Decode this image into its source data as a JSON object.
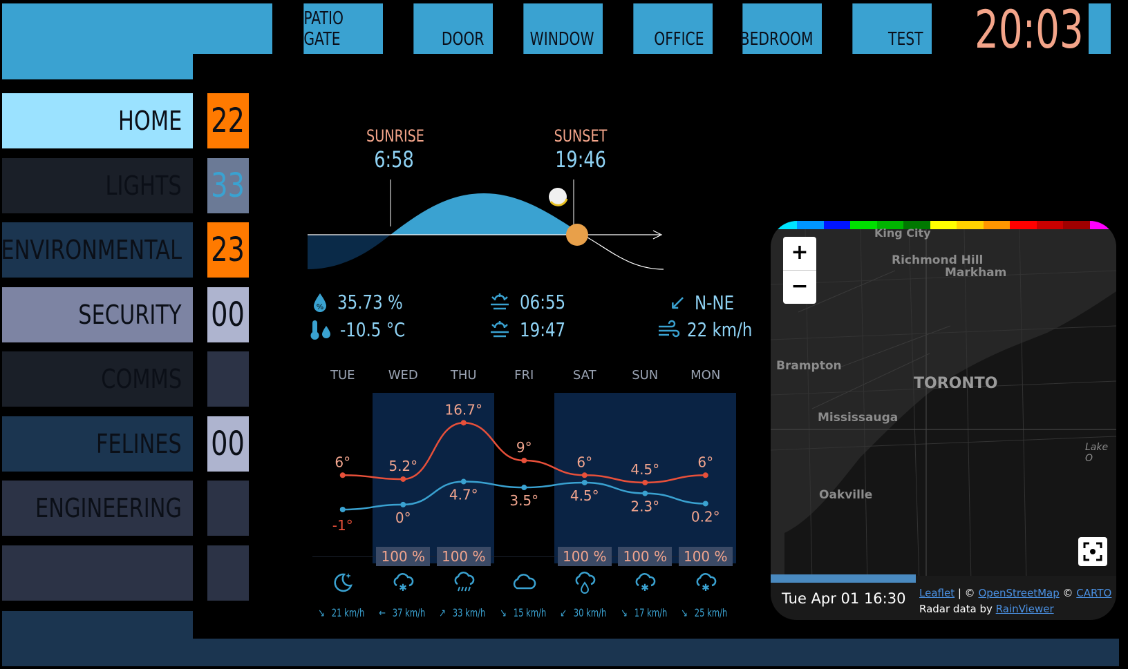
{
  "clock": "20:03",
  "doors": [
    "PATIO GATE",
    "DOOR",
    "WINDOW",
    "OFFICE",
    "BEDROOM",
    "TEST"
  ],
  "sidebar": {
    "items": [
      {
        "label": "HOME",
        "count": "22",
        "bg": "#9be2ff",
        "count_bg": "#ff7a00",
        "count_color": "#0b0f17"
      },
      {
        "label": "LIGHTS",
        "count": "33",
        "bg": "#1a1f28",
        "count_bg": "#6b7a96",
        "count_color": "#3aa2d1"
      },
      {
        "label": "ENVIRONMENTAL",
        "count": "23",
        "bg": "#1b3550",
        "count_bg": "#ff7a00",
        "count_color": "#0b0f17"
      },
      {
        "label": "SECURITY",
        "count": "00",
        "bg": "#7d84a3",
        "count_bg": "#aeb4cf",
        "count_color": "#0b0f17"
      },
      {
        "label": "COMMS",
        "count": "",
        "bg": "#1a1f28",
        "count_bg": "#2c3346",
        "count_color": "#0b0f17"
      },
      {
        "label": "FELINES",
        "count": "00",
        "bg": "#1b3550",
        "count_bg": "#aeb4cf",
        "count_color": "#0b0f17"
      },
      {
        "label": "ENGINEERING",
        "count": "",
        "bg": "#2c3346",
        "count_bg": "#2c3346",
        "count_color": "#0b0f17"
      },
      {
        "label": "",
        "count": "",
        "bg": "#2c3346",
        "count_bg": "#2c3346",
        "count_color": "#0b0f17"
      }
    ]
  },
  "sun": {
    "sunrise_label": "SUNRISE",
    "sunrise_time": "6:58",
    "sunset_label": "SUNSET",
    "sunset_time": "19:46"
  },
  "stats": {
    "humidity": "35.73 %",
    "temperature": "-10.5 °C",
    "sunrise_next": "06:55",
    "sunset_next": "19:47",
    "wind_dir": "N-NE",
    "wind_speed": "22 km/h"
  },
  "forecast": {
    "days": [
      "TUE",
      "WED",
      "THU",
      "FRI",
      "SAT",
      "SUN",
      "MON"
    ],
    "high_labels": [
      "6°",
      "5.2°",
      "16.7°",
      "9°",
      "6°",
      "4.5°",
      "6°"
    ],
    "low_labels": [
      "-1°",
      "0°",
      "4.7°",
      "3.5°",
      "4.5°",
      "2.3°",
      "0.2°"
    ],
    "precip": [
      "",
      "100 %",
      "100 %",
      "",
      "100 %",
      "100 %",
      "100 %"
    ],
    "icons": [
      "moon-star-icon",
      "cloud-snow-icon",
      "cloud-rain-icon",
      "cloud-icon",
      "cloud-drop-icon",
      "cloud-snow-icon",
      "cloud-snow-icon"
    ],
    "wind": [
      {
        "arrow": "↘",
        "speed": "21 km/h"
      },
      {
        "arrow": "←",
        "speed": "37 km/h"
      },
      {
        "arrow": "↗",
        "speed": "33 km/h"
      },
      {
        "arrow": "↘",
        "speed": "15 km/h"
      },
      {
        "arrow": "↙",
        "speed": "30 km/h"
      },
      {
        "arrow": "↘",
        "speed": "17 km/h"
      },
      {
        "arrow": "↘",
        "speed": "25 km/h"
      }
    ]
  },
  "chart_data": {
    "type": "line",
    "categories": [
      "TUE",
      "WED",
      "THU",
      "FRI",
      "SAT",
      "SUN",
      "MON"
    ],
    "series": [
      {
        "values": [
          6,
          5.2,
          16.7,
          9,
          6,
          4.5,
          6
        ],
        "color": "#e8503a"
      },
      {
        "values": [
          -1,
          0,
          4.7,
          3.5,
          4.5,
          2.3,
          0.2
        ],
        "color": "#3aa2d1"
      }
    ]
  },
  "map": {
    "zoom_in": "+",
    "zoom_out": "−",
    "timestamp": "Tue Apr 01 16:30",
    "attribution_leaflet": "Leaflet",
    "attribution_sep1": " | © ",
    "attribution_osm": "OpenStreetMap",
    "attribution_sep2": " © ",
    "attribution_carto": "CARTO",
    "radar_prefix": "Radar data by ",
    "radar_link": "RainViewer",
    "places": [
      "King City",
      "Richmond Hill",
      "Markham",
      "Brampton",
      "TORONTO",
      "Mississauga",
      "Oakville",
      "Lake O"
    ],
    "radar_colors": [
      "#00e5ff",
      "#0096ff",
      "#0014ff",
      "#00e000",
      "#00b400",
      "#007800",
      "#ffff00",
      "#ffd200",
      "#ff9600",
      "#ff0000",
      "#c80000",
      "#a00000",
      "#ff00ff"
    ]
  }
}
